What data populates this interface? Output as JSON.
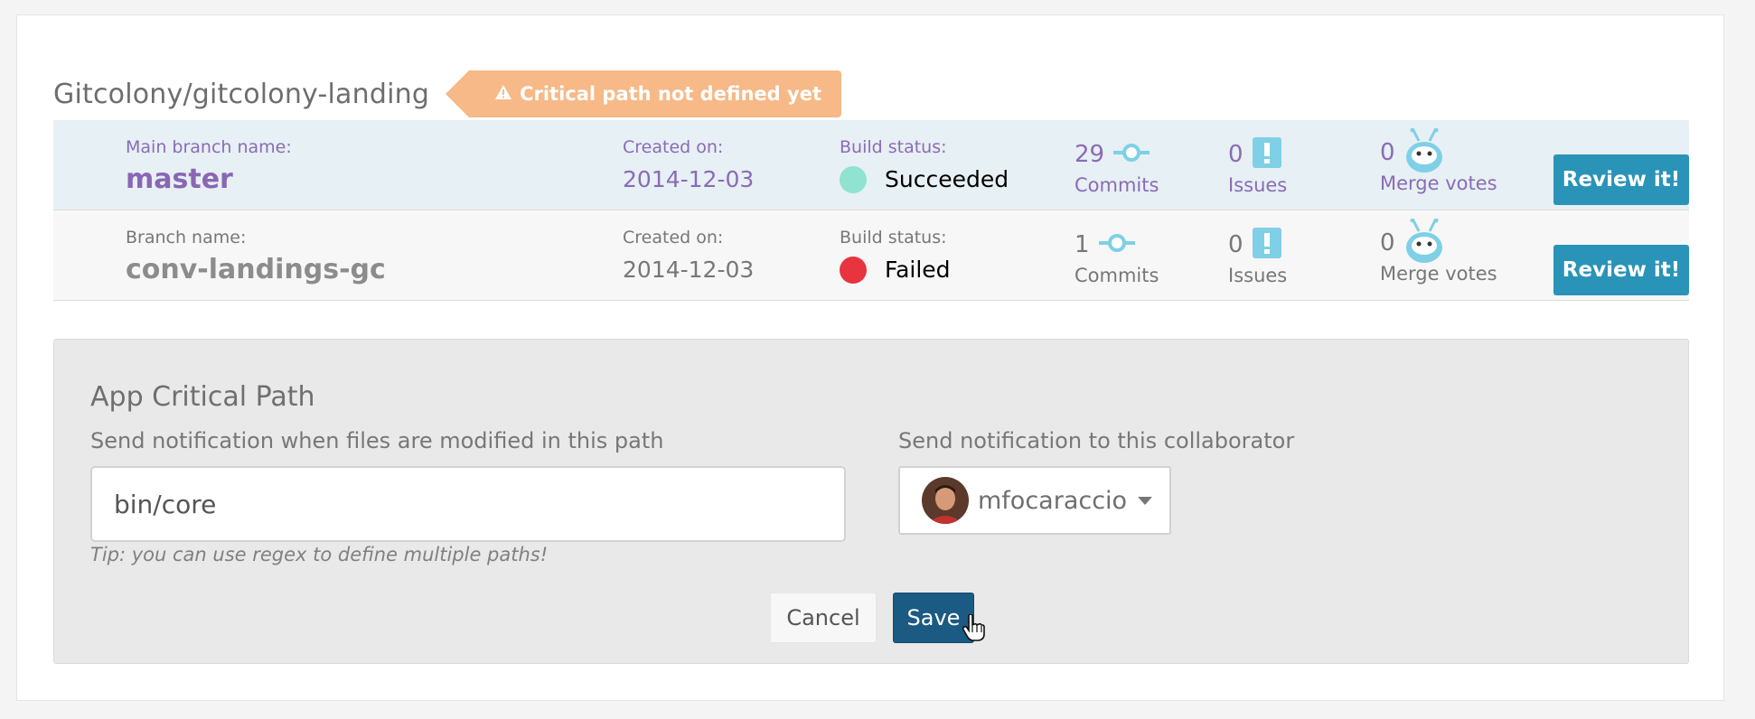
{
  "repo": {
    "title": "Gitcolony/gitcolony-landing",
    "warning": "Critical path not defined yet",
    "warning_icon": "warning-triangle-icon"
  },
  "branches": [
    {
      "name_label": "Main branch name:",
      "name": "master",
      "created_label": "Created on:",
      "created": "2014-12-03",
      "build_label": "Build status:",
      "build_status": "Succeeded",
      "build_color": "#8fe3d0",
      "commits": "29",
      "commits_label": "Commits",
      "issues": "0",
      "issues_label": "Issues",
      "votes": "0",
      "votes_label": "Merge votes",
      "button": "Review it!"
    },
    {
      "name_label": "Branch name:",
      "name": "conv-landings-gc",
      "created_label": "Created on:",
      "created": "2014-12-03",
      "build_label": "Build status:",
      "build_status": "Failed",
      "build_color": "#e8343f",
      "commits": "1",
      "commits_label": "Commits",
      "issues": "0",
      "issues_label": "Issues",
      "votes": "0",
      "votes_label": "Merge votes",
      "button": "Review it!"
    }
  ],
  "critical_path": {
    "title": "App Critical Path",
    "path_label": "Send notification when files are modified in this path",
    "path_value": "bin/core",
    "tip": "Tip: you can use regex to define multiple paths!",
    "collab_label": "Send notification to this collaborator",
    "collaborator": "mfocaraccio",
    "cancel": "Cancel",
    "save": "Save"
  },
  "colors": {
    "accent_blue": "#2a93b8",
    "save_blue": "#1a5a83",
    "warning_orange": "#f6b987",
    "branch_purple": "#8a66b4",
    "icon_cyan": "#7fd0e6"
  }
}
